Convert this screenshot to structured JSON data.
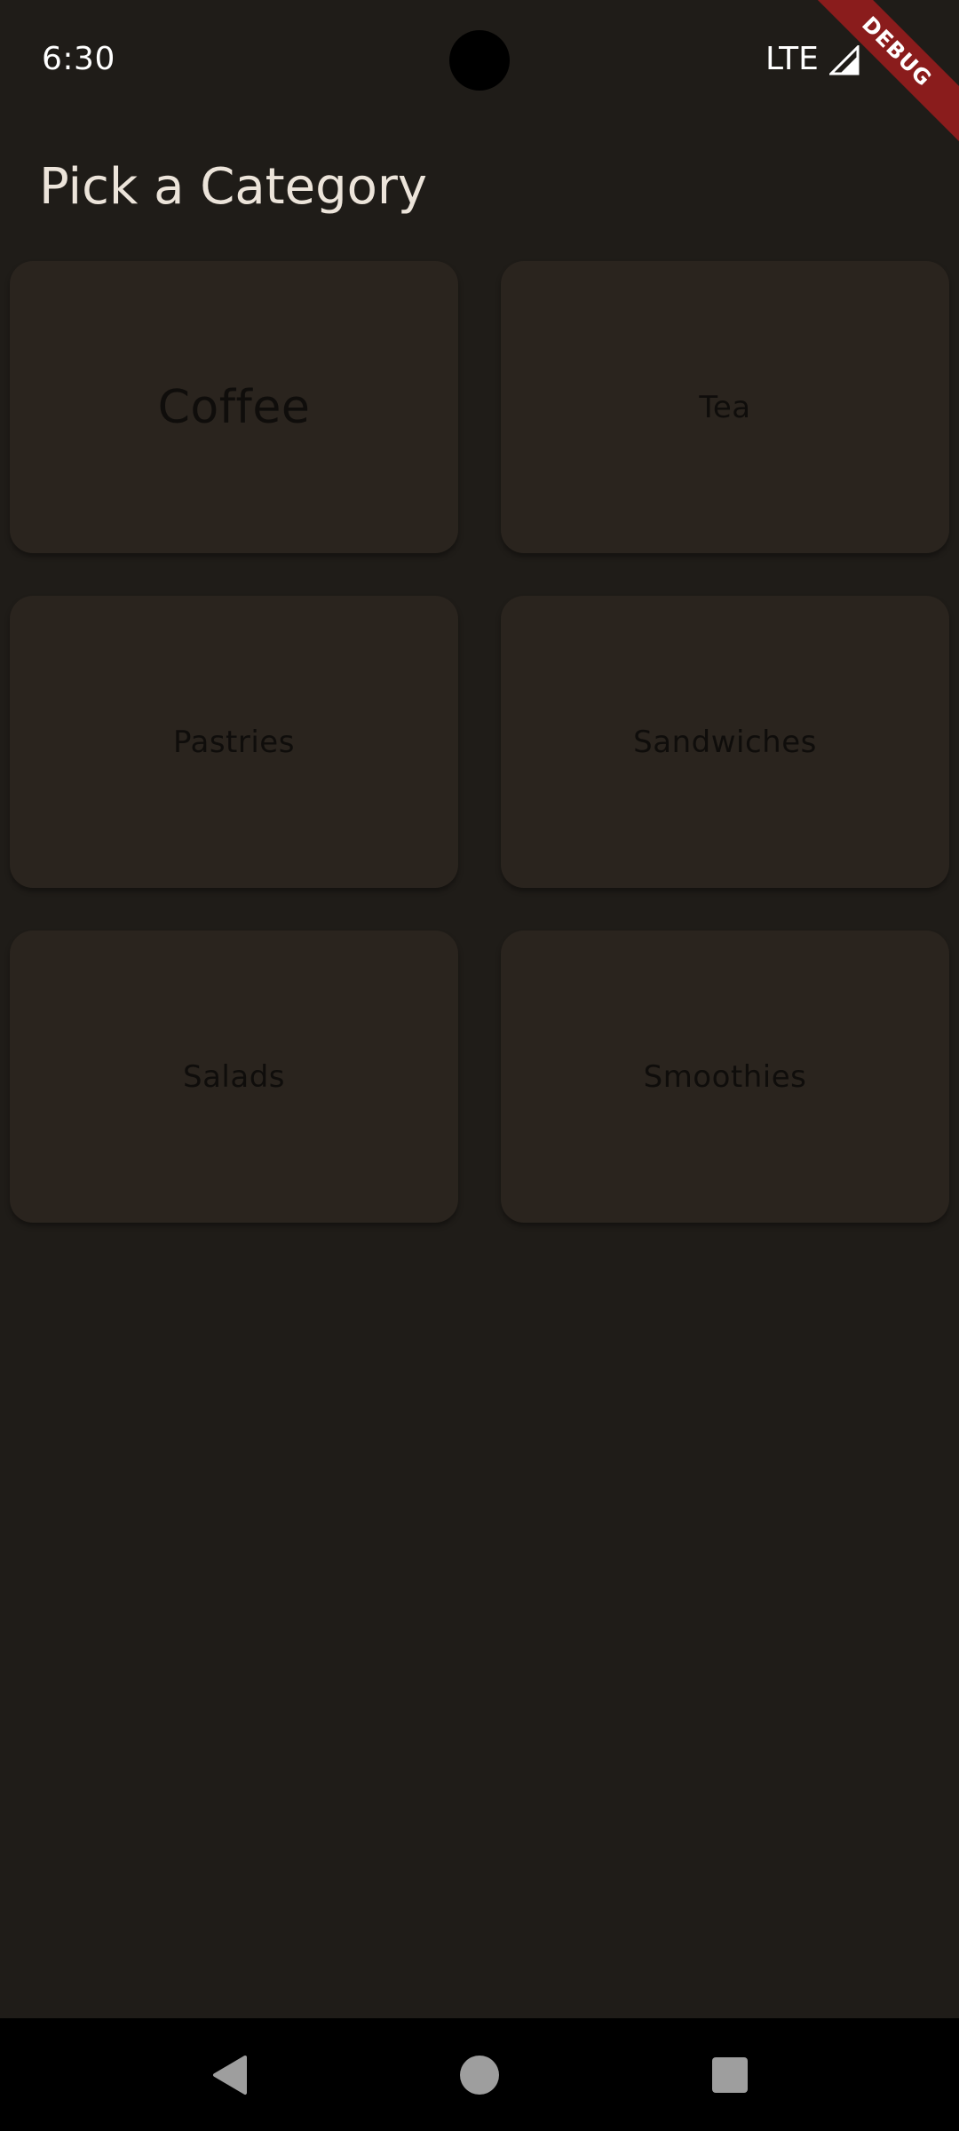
{
  "status_bar": {
    "time": "6:30",
    "network": "LTE",
    "icons": [
      "signal-icon"
    ]
  },
  "debug_banner": {
    "label": "DEBUG",
    "color": "#8a1c1c"
  },
  "page": {
    "title": "Pick a Category"
  },
  "categories": [
    {
      "label": "Coffee"
    },
    {
      "label": "Tea"
    },
    {
      "label": "Pastries"
    },
    {
      "label": "Sandwiches"
    },
    {
      "label": "Salads"
    },
    {
      "label": "Smoothies"
    }
  ],
  "nav_bar": {
    "buttons": [
      "back-icon",
      "home-icon",
      "recents-icon"
    ]
  },
  "colors": {
    "background": "#1f1c18",
    "card": "#2a241e",
    "title_text": "#ece4da",
    "card_text": "#0f0d0b"
  }
}
